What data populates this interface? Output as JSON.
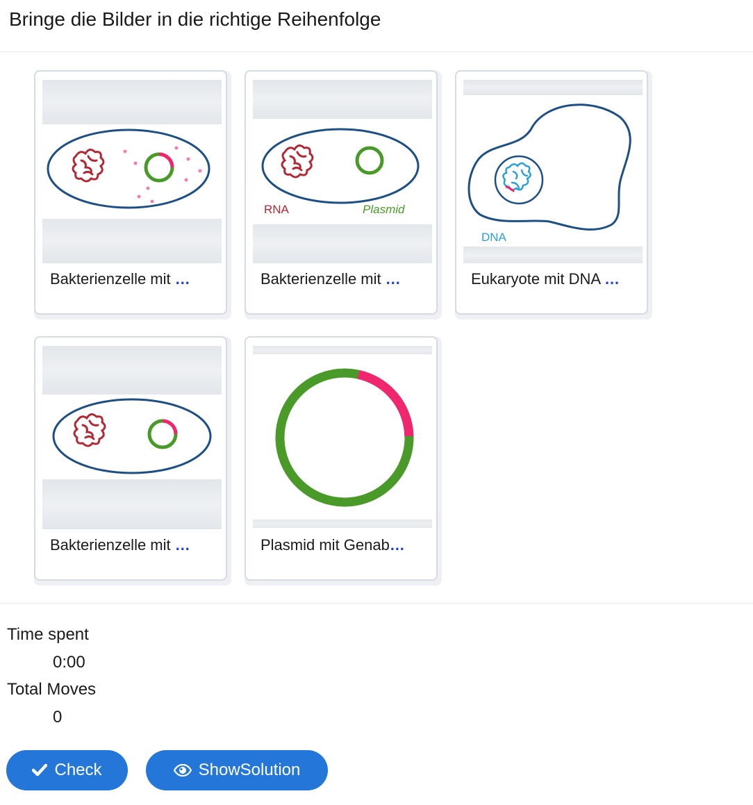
{
  "header": {
    "title": "Bringe die Bilder in die richtige Reihenfolge"
  },
  "cards": [
    {
      "caption": "Bakterienzelle mit",
      "more": "…",
      "image": "bacterium-with-dna-plasmid-ribosomes"
    },
    {
      "caption": "Bakterienzelle mit",
      "more": "…",
      "image": "bacterium-labelled-rna-plasmid",
      "labels": {
        "rna": "RNA",
        "plasmid": "Plasmid"
      }
    },
    {
      "caption": "Eukaryote mit DNA",
      "more": "…",
      "image": "eukaryote-with-nucleus",
      "labels": {
        "dna": "DNA"
      }
    },
    {
      "caption": "Bakterienzelle mit",
      "more": "…",
      "image": "bacterium-with-plasmid"
    },
    {
      "caption": "Plasmid mit Genab",
      "more": "…",
      "image": "plasmid-ring-with-gene-section"
    }
  ],
  "stats": {
    "time_label": "Time spent",
    "time_value": "0:00",
    "moves_label": "Total Moves",
    "moves_value": "0"
  },
  "buttons": {
    "check_label": "Check",
    "check_icon": "checkmark-icon",
    "solution_label": "ShowSolution",
    "solution_icon": "eye-icon"
  },
  "colors": {
    "accent": "#2576d9",
    "more_link": "#1f3fd4",
    "cell_outline": "#1d4f85",
    "dna_red": "#b02a35",
    "plasmid_green": "#4a9a2a",
    "gene_pink": "#f0266e",
    "eukaryote_dna": "#2c9fd8"
  }
}
